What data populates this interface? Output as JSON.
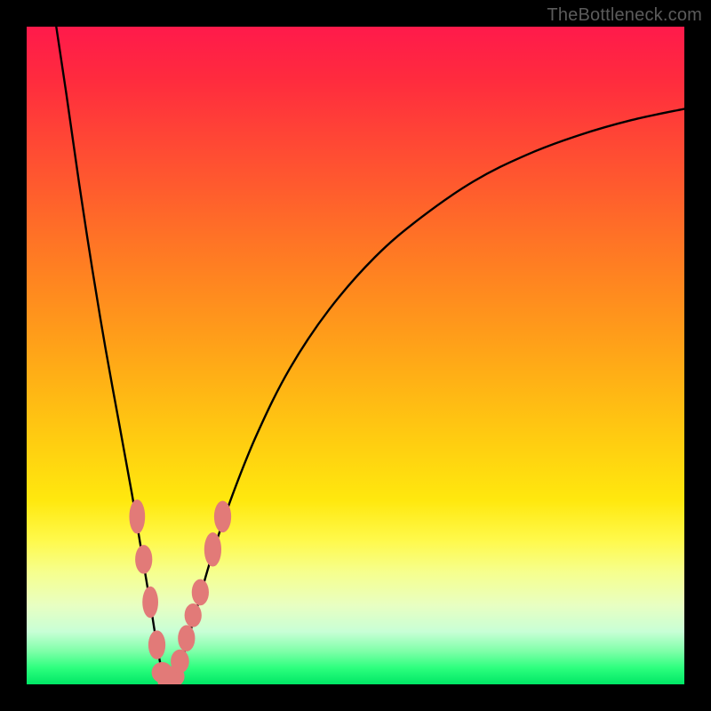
{
  "watermark": "TheBottleneck.com",
  "chart_data": {
    "type": "line",
    "title": "",
    "xlabel": "",
    "ylabel": "",
    "xlim": [
      0,
      100
    ],
    "ylim": [
      0,
      100
    ],
    "grid": false,
    "legend": false,
    "series": [
      {
        "name": "bottleneck-curve",
        "color": "#000000",
        "x": [
          4.5,
          6,
          8,
          10,
          12,
          14,
          16,
          17,
          18,
          19,
          19.8,
          20.6,
          21.5,
          22.5,
          24,
          26,
          28,
          31,
          35,
          40,
          46,
          53,
          60,
          68,
          76,
          84,
          92,
          100
        ],
        "y": [
          100,
          90,
          76,
          63,
          51,
          40,
          29,
          23,
          17,
          11,
          6,
          2,
          0.3,
          1.2,
          5,
          12,
          19,
          28,
          38,
          48,
          57,
          65,
          71,
          76.5,
          80.5,
          83.5,
          85.8,
          87.5
        ]
      }
    ],
    "markers": {
      "name": "highlight-points",
      "color": "#e27a78",
      "points": [
        {
          "x": 16.8,
          "y": 25.5,
          "rx": 1.2,
          "ry": 2.6
        },
        {
          "x": 17.8,
          "y": 19.0,
          "rx": 1.3,
          "ry": 2.2
        },
        {
          "x": 18.8,
          "y": 12.5,
          "rx": 1.2,
          "ry": 2.4
        },
        {
          "x": 19.8,
          "y": 6.0,
          "rx": 1.3,
          "ry": 2.2
        },
        {
          "x": 20.6,
          "y": 1.8,
          "rx": 1.6,
          "ry": 1.6
        },
        {
          "x": 21.5,
          "y": 0.5,
          "rx": 1.6,
          "ry": 1.6
        },
        {
          "x": 22.4,
          "y": 1.2,
          "rx": 1.6,
          "ry": 1.6
        },
        {
          "x": 23.3,
          "y": 3.5,
          "rx": 1.4,
          "ry": 1.8
        },
        {
          "x": 24.3,
          "y": 7.0,
          "rx": 1.3,
          "ry": 2.0
        },
        {
          "x": 25.3,
          "y": 10.5,
          "rx": 1.3,
          "ry": 1.8
        },
        {
          "x": 26.4,
          "y": 14.0,
          "rx": 1.3,
          "ry": 2.0
        },
        {
          "x": 28.3,
          "y": 20.5,
          "rx": 1.3,
          "ry": 2.6
        },
        {
          "x": 29.8,
          "y": 25.5,
          "rx": 1.3,
          "ry": 2.4
        }
      ]
    }
  }
}
